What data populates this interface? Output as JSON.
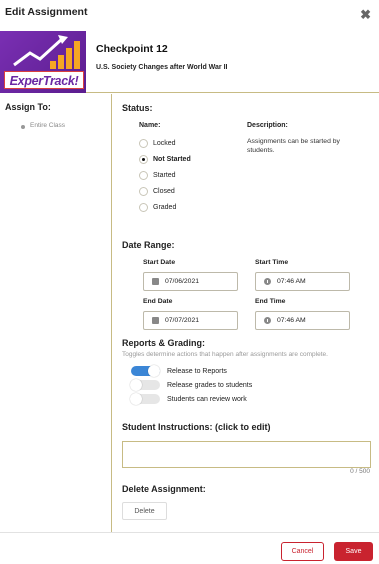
{
  "modal": {
    "title": "Edit Assignment",
    "close_icon": "close-icon"
  },
  "banner": {
    "logo_text": "ExperTrack!",
    "checkpoint_title": "Checkpoint 12",
    "checkpoint_subtitle": "U.S. Society Changes after World War II"
  },
  "assign_to": {
    "title": "Assign To:",
    "items": [
      "Entire Class"
    ]
  },
  "status": {
    "title": "Status:",
    "name_header": "Name:",
    "description_header": "Description:",
    "options": [
      {
        "label": "Locked",
        "selected": false
      },
      {
        "label": "Not Started",
        "selected": true
      },
      {
        "label": "Started",
        "selected": false
      },
      {
        "label": "Closed",
        "selected": false
      },
      {
        "label": "Graded",
        "selected": false
      }
    ],
    "description": "Assignments can be started by students."
  },
  "date_range": {
    "title": "Date Range:",
    "start_date_label": "Start Date",
    "start_date": "07/06/2021",
    "start_time_label": "Start Time",
    "start_time": "07:46 AM",
    "end_date_label": "End Date",
    "end_date": "07/07/2021",
    "end_time_label": "End Time",
    "end_time": "07:46 AM"
  },
  "reports": {
    "title": "Reports & Grading:",
    "hint": "Toggles determine actions that happen after assignments are complete.",
    "toggles": [
      {
        "label": "Release to Reports",
        "on": true
      },
      {
        "label": "Release grades to students",
        "on": false
      },
      {
        "label": "Students can review work",
        "on": false
      }
    ]
  },
  "instructions": {
    "title": "Student Instructions: (click to edit)",
    "value": "",
    "counter": "0 / 500"
  },
  "delete_section": {
    "title": "Delete Assignment:",
    "button": "Delete"
  },
  "footer": {
    "cancel": "Cancel",
    "save": "Save"
  },
  "colors": {
    "accent_red": "#c9232f",
    "toggle_on": "#3b86d6",
    "divider": "#c7bb84",
    "logo_purple": "#6a28a4"
  }
}
